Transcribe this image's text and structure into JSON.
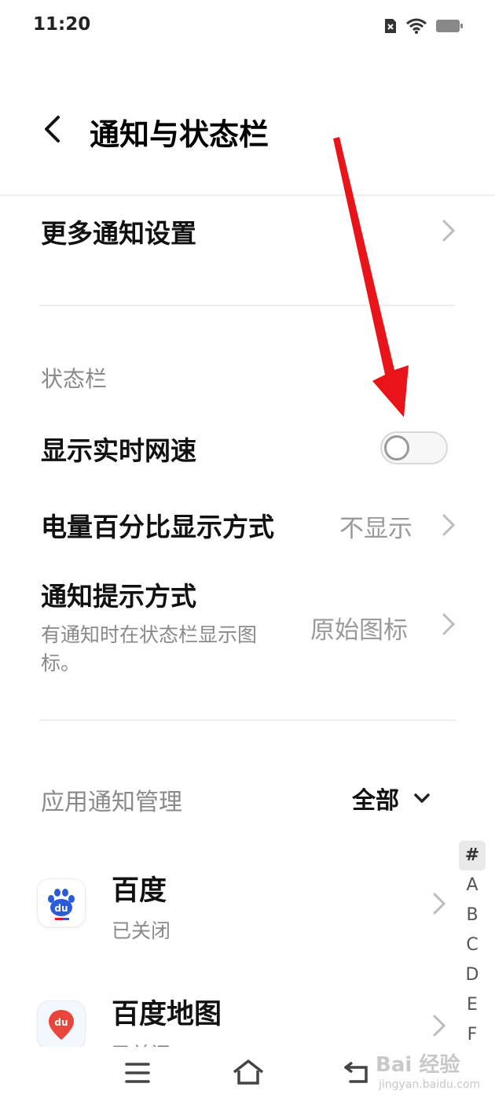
{
  "status_bar": {
    "time": "11:20"
  },
  "header": {
    "title": "通知与状态栏"
  },
  "rows": {
    "more_settings": {
      "label": "更多通知设置"
    },
    "status_section": {
      "label": "状态栏"
    },
    "network_speed": {
      "label": "显示实时网速",
      "enabled": false
    },
    "battery_percent": {
      "label": "电量百分比显示方式",
      "value": "不显示"
    },
    "notify_style": {
      "label": "通知提示方式",
      "description": "有通知时在状态栏显示图标。",
      "desc_line1": "有通知时在状态栏显示图",
      "desc_line2": "标。",
      "value": "原始图标"
    }
  },
  "app_notifications": {
    "section_label": "应用通知管理",
    "filter": "全部",
    "apps": [
      {
        "name": "百度",
        "status": "已关闭",
        "icon": "baidu-paw-icon"
      },
      {
        "name": "百度地图",
        "status": "已关闭",
        "icon": "baidu-map-pin-icon"
      }
    ]
  },
  "index_bar": [
    "#",
    "A",
    "B",
    "C",
    "D",
    "E",
    "F"
  ],
  "watermark": {
    "text": "Bai 经验",
    "sub": "jingyan.baidu.com"
  },
  "colors": {
    "arrow": "#e8141a",
    "baidu_blue": "#2a5cd9",
    "map_red": "#e8453c"
  }
}
